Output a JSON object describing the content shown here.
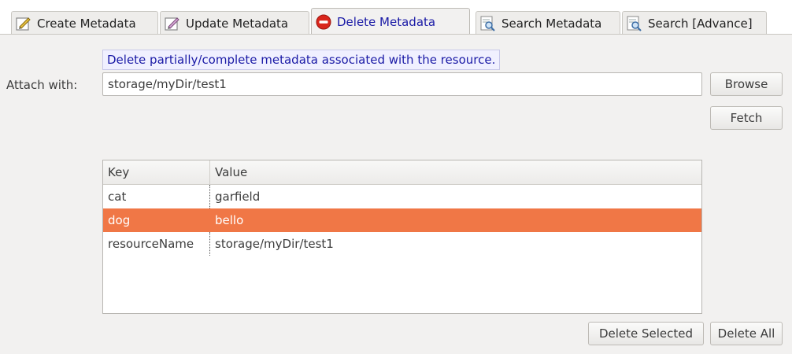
{
  "tabs": [
    {
      "label": "Create Metadata",
      "icon": "edit-icon"
    },
    {
      "label": "Update Metadata",
      "icon": "update-edit-icon"
    },
    {
      "label": "Delete Metadata",
      "icon": "delete-stop-icon",
      "active": true
    },
    {
      "label": "Search Metadata",
      "icon": "search-icon"
    },
    {
      "label": "Search [Advance]",
      "icon": "advanced-search-icon"
    }
  ],
  "hint": "Delete partially/complete metadata associated with the resource.",
  "attach": {
    "label": "Attach with:",
    "value": "storage/myDir/test1"
  },
  "buttons": {
    "browse": "Browse",
    "fetch": "Fetch",
    "delete_selected": "Delete Selected",
    "delete_all": "Delete All"
  },
  "table": {
    "columns": [
      "Key",
      "Value"
    ],
    "rows": [
      {
        "key": "cat",
        "value": "garfield"
      },
      {
        "key": "dog",
        "value": "bello",
        "selected": true
      },
      {
        "key": "resourceName",
        "value": "storage/myDir/test1"
      }
    ]
  },
  "colors": {
    "selection": "#f07746",
    "hint_text": "#1a1aa6",
    "panel_bg": "#f2f1f0"
  }
}
